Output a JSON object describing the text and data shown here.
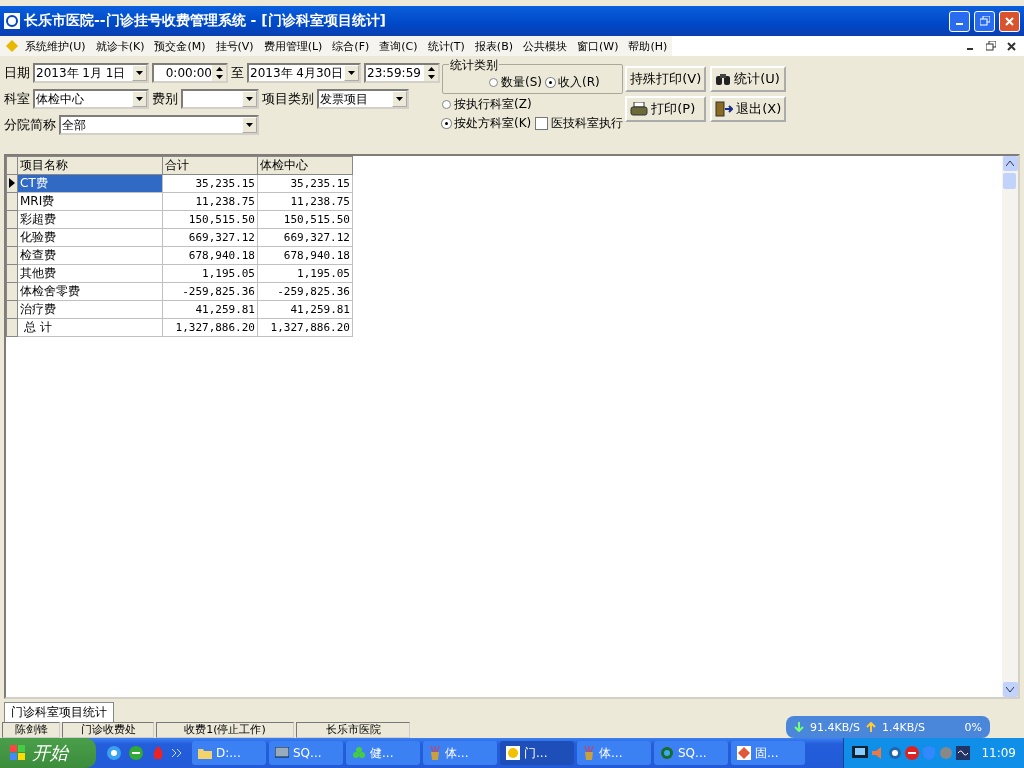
{
  "window": {
    "title": "长乐市医院--门诊挂号收费管理系统 - [门诊科室项目统计]"
  },
  "menu": [
    "系统维护(U)",
    "就诊卡(K)",
    "预交金(M)",
    "挂号(V)",
    "费用管理(L)",
    "综合(F)",
    "查询(C)",
    "统计(T)",
    "报表(B)",
    "公共模块",
    "窗口(W)",
    "帮助(H)"
  ],
  "filters": {
    "date_label": "日期",
    "date_from": "2013年 1月 1日",
    "time_from": "0:00:00",
    "to_label": "至",
    "date_to": "2013年 4月30日",
    "time_to": "23:59:59",
    "dept_label": "科室",
    "dept": "体检中心",
    "fee_label": "费别",
    "item_type_label": "项目类别",
    "item_type": "发票项目",
    "branch_label": "分院简称",
    "branch": "全部"
  },
  "stat_type": {
    "title": "统计类别",
    "options": [
      {
        "label": "数量(S)",
        "selected": false
      },
      {
        "label": "收入(R)",
        "selected": true
      }
    ]
  },
  "dept_mode": [
    {
      "label": "按执行科室(Z)",
      "selected": false
    },
    {
      "label": "按处方科室(K)",
      "selected": true
    }
  ],
  "medtech_checkbox": {
    "label": "医技科室执行",
    "checked": false
  },
  "buttons": [
    {
      "label": "持殊打印(V)",
      "kind": "text"
    },
    {
      "label": "统计(U)",
      "kind": "binoculars"
    },
    {
      "label": "打印(P)",
      "kind": "printer"
    },
    {
      "label": "退出(X)",
      "kind": "exit"
    }
  ],
  "table": {
    "columns": [
      "项目名称",
      "合计",
      "体检中心"
    ],
    "rows": [
      {
        "cells": [
          "CT费",
          "35,235.15",
          "35,235.15"
        ],
        "selected": true
      },
      {
        "cells": [
          "MRI费",
          "11,238.75",
          "11,238.75"
        ],
        "selected": false
      },
      {
        "cells": [
          "彩超费",
          "150,515.50",
          "150,515.50"
        ],
        "selected": false
      },
      {
        "cells": [
          "化验费",
          "669,327.12",
          "669,327.12"
        ],
        "selected": false
      },
      {
        "cells": [
          "检查费",
          "678,940.18",
          "678,940.18"
        ],
        "selected": false
      },
      {
        "cells": [
          "其他费",
          "1,195.05",
          "1,195.05"
        ],
        "selected": false
      },
      {
        "cells": [
          "体检舍零费",
          "-259,825.36",
          "-259,825.36"
        ],
        "selected": false
      },
      {
        "cells": [
          "治疗费",
          "41,259.81",
          "41,259.81"
        ],
        "selected": false
      },
      {
        "cells": [
          " 总 计",
          "1,327,886.20",
          "1,327,886.20"
        ],
        "selected": false
      }
    ]
  },
  "tabs": [
    {
      "label": "门诊科室项目统计",
      "selected": true
    }
  ],
  "status_bar": [
    "陈剑锋",
    "门诊收费处",
    "收费1(停止工作)",
    "长乐市医院"
  ],
  "net_monitor": {
    "download": "91.4KB/S",
    "upload": "1.4KB/S",
    "cpu": "0%"
  },
  "taskbar": {
    "start": "开始",
    "tasks": [
      {
        "label": "D:...",
        "kind": "folder",
        "selected": false
      },
      {
        "label": "SQ...",
        "kind": "monitor",
        "selected": false
      },
      {
        "label": "健...",
        "kind": "leaf",
        "selected": false
      },
      {
        "label": "体...",
        "kind": "tool",
        "selected": false
      },
      {
        "label": "门...",
        "kind": "app",
        "selected": true
      },
      {
        "label": "体...",
        "kind": "tool",
        "selected": false
      },
      {
        "label": "SQ...",
        "kind": "globe",
        "selected": false
      },
      {
        "label": "固...",
        "kind": "app2",
        "selected": false
      }
    ],
    "clock": "11:09"
  }
}
